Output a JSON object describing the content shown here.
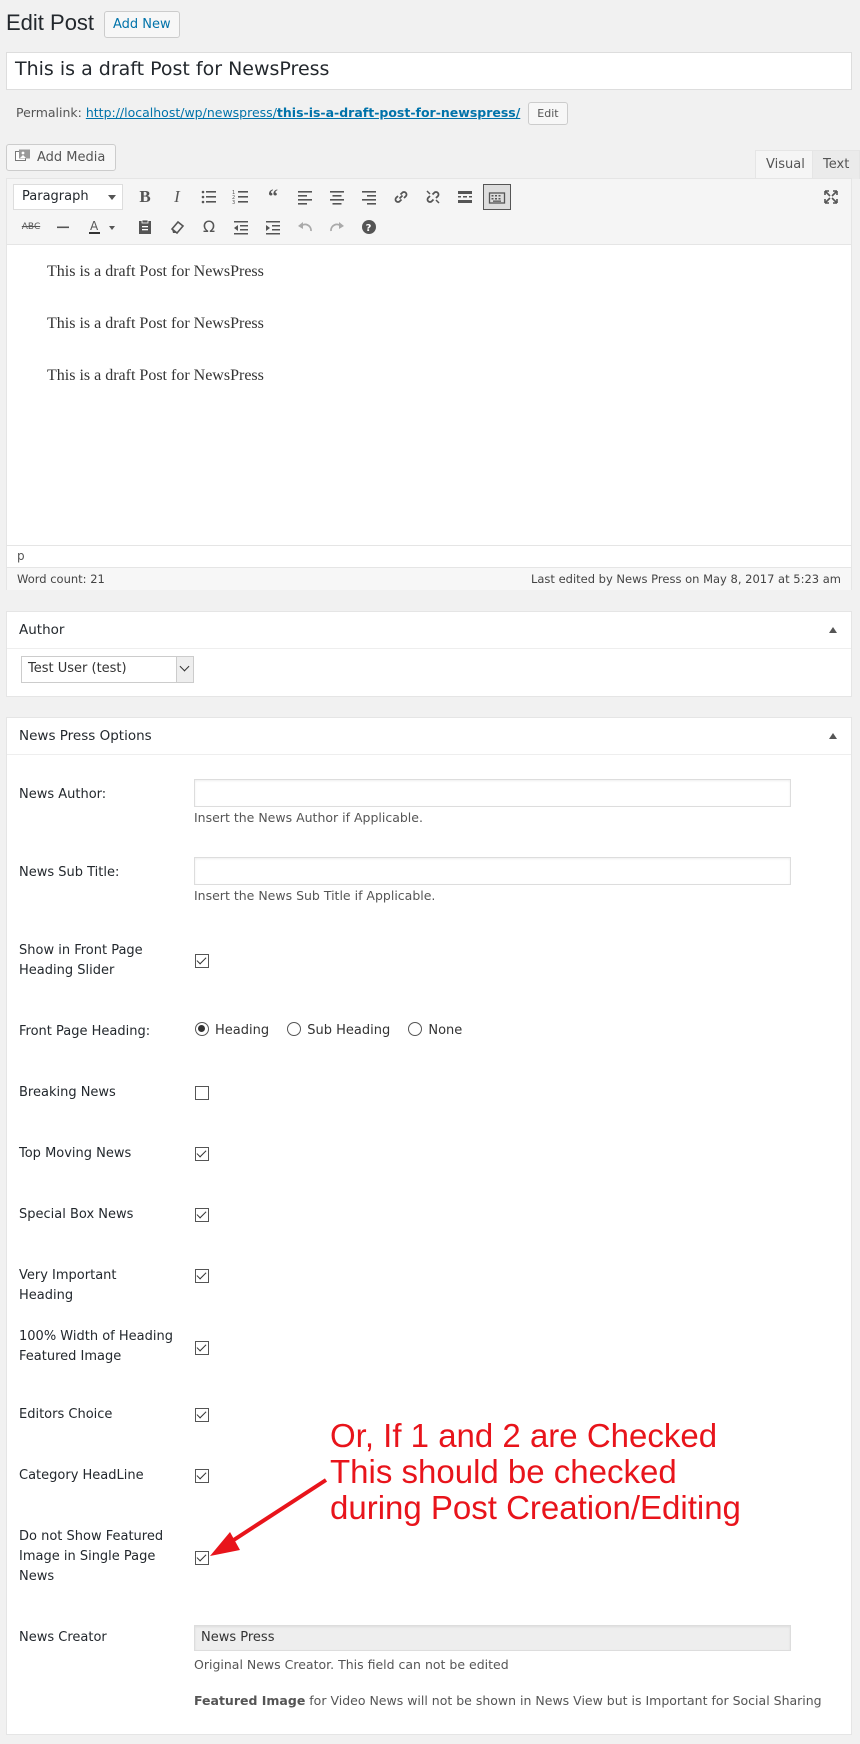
{
  "header": {
    "title": "Edit Post",
    "add_new": "Add New",
    "post_title": "This is a draft Post for NewsPress",
    "permalink_label": "Permalink:",
    "permalink_base": "http://localhost/wp/newspress/",
    "permalink_slug": "this-is-a-draft-post-for-newspress/",
    "permalink_edit": "Edit"
  },
  "editor": {
    "add_media": "Add Media",
    "tab_visual": "Visual",
    "tab_text": "Text",
    "format_select": "Paragraph",
    "paragraphs": [
      "This is a draft Post for NewsPress",
      "This is a draft Post for NewsPress",
      "This is a draft Post for NewsPress"
    ],
    "path": "p",
    "word_count": "Word count: 21",
    "last_edited": "Last edited by News Press on May 8, 2017 at 5:23 am"
  },
  "author_box": {
    "title": "Author",
    "selected": "Test User (test)"
  },
  "options_box": {
    "title": "News Press Options",
    "news_author_label": "News Author:",
    "news_author_desc": "Insert the News Author if Applicable.",
    "news_subtitle_label": "News Sub Title:",
    "news_subtitle_desc": "Insert the News Sub Title if Applicable.",
    "front_slider_label": "Show in Front Page Heading Slider",
    "front_heading_label": "Front Page Heading:",
    "front_heading_options": [
      "Heading",
      "Sub Heading",
      "None"
    ],
    "breaking_label": "Breaking News",
    "top_moving_label": "Top Moving News",
    "special_box_label": "Special Box News",
    "very_important_label": "Very Important Heading",
    "full_width_label": "100% Width of Heading Featured Image",
    "editors_choice_label": "Editors Choice",
    "category_headline_label": "Category HeadLine",
    "no_featured_label": "Do not Show Featured Image in Single Page News",
    "news_creator_label": "News Creator",
    "news_creator_value": "News Press",
    "news_creator_desc": "Original News Creator. This field can not be edited",
    "featured_note_bold": "Featured Image",
    "featured_note_rest": " for Video News will not be shown in News View but is Important for Social Sharing"
  },
  "annotation": {
    "line1": "Or, If 1 and 2 are Checked",
    "line2": "This should be checked",
    "line3": "during Post Creation/Editing",
    "color": "#e8141b"
  }
}
